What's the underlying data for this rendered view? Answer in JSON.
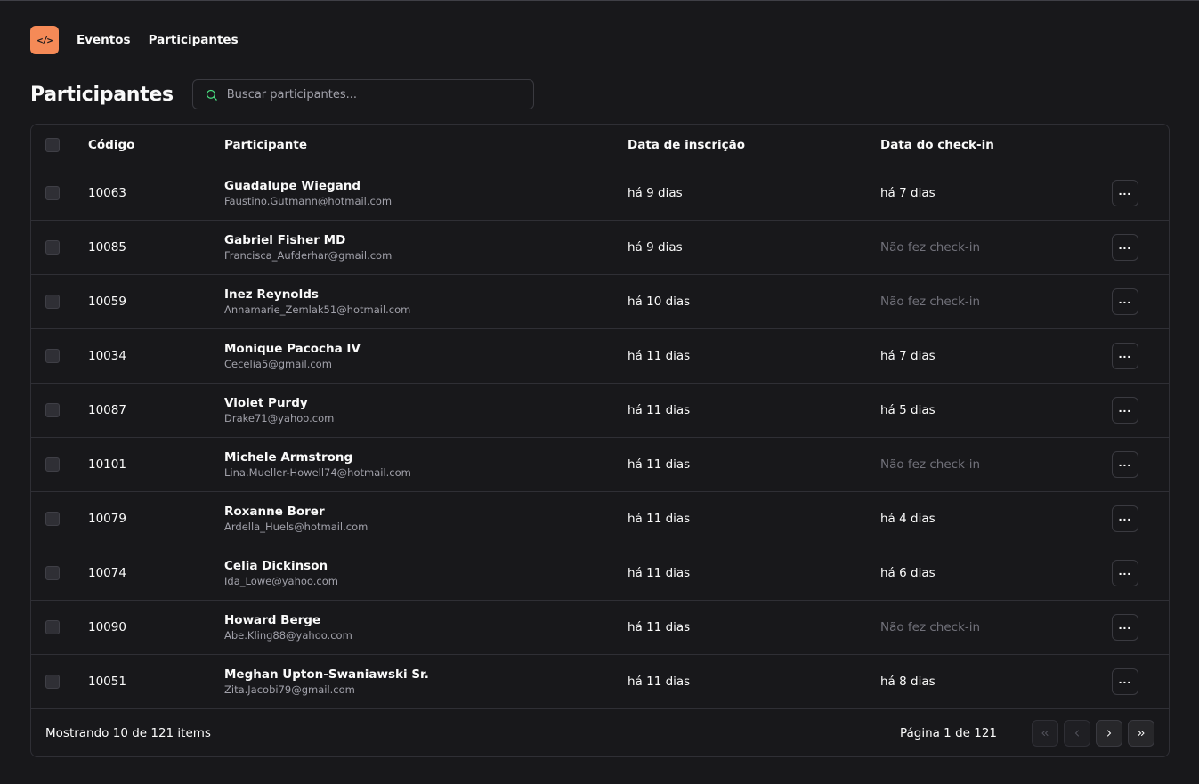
{
  "nav": {
    "logo_text": "</>",
    "items": [
      "Eventos",
      "Participantes"
    ]
  },
  "header": {
    "title": "Participantes",
    "search_placeholder": "Buscar participantes..."
  },
  "table": {
    "columns": [
      "Código",
      "Participante",
      "Data de inscrição",
      "Data do check-in"
    ],
    "rows": [
      {
        "code": "10063",
        "name": "Guadalupe Wiegand",
        "email": "Faustino.Gutmann@hotmail.com",
        "registered": "há 9 dias",
        "checkin": "há 7 dias",
        "checked_in": true
      },
      {
        "code": "10085",
        "name": "Gabriel Fisher MD",
        "email": "Francisca_Aufderhar@gmail.com",
        "registered": "há 9 dias",
        "checkin": "Não fez check-in",
        "checked_in": false
      },
      {
        "code": "10059",
        "name": "Inez Reynolds",
        "email": "Annamarie_Zemlak51@hotmail.com",
        "registered": "há 10 dias",
        "checkin": "Não fez check-in",
        "checked_in": false
      },
      {
        "code": "10034",
        "name": "Monique Pacocha IV",
        "email": "Cecelia5@gmail.com",
        "registered": "há 11 dias",
        "checkin": "há 7 dias",
        "checked_in": true
      },
      {
        "code": "10087",
        "name": "Violet Purdy",
        "email": "Drake71@yahoo.com",
        "registered": "há 11 dias",
        "checkin": "há 5 dias",
        "checked_in": true
      },
      {
        "code": "10101",
        "name": "Michele Armstrong",
        "email": "Lina.Mueller-Howell74@hotmail.com",
        "registered": "há 11 dias",
        "checkin": "Não fez check-in",
        "checked_in": false
      },
      {
        "code": "10079",
        "name": "Roxanne Borer",
        "email": "Ardella_Huels@hotmail.com",
        "registered": "há 11 dias",
        "checkin": "há 4 dias",
        "checked_in": true
      },
      {
        "code": "10074",
        "name": "Celia Dickinson",
        "email": "Ida_Lowe@yahoo.com",
        "registered": "há 11 dias",
        "checkin": "há 6 dias",
        "checked_in": true
      },
      {
        "code": "10090",
        "name": "Howard Berge",
        "email": "Abe.Kling88@yahoo.com",
        "registered": "há 11 dias",
        "checkin": "Não fez check-in",
        "checked_in": false
      },
      {
        "code": "10051",
        "name": "Meghan Upton-Swaniawski Sr.",
        "email": "Zita.Jacobi79@gmail.com",
        "registered": "há 11 dias",
        "checkin": "há 8 dias",
        "checked_in": true
      }
    ]
  },
  "footer": {
    "showing": "Mostrando 10 de 121 items",
    "page_info": "Página 1 de 121"
  },
  "colors": {
    "background": "#18181b",
    "accent": "#f58a57",
    "border": "#2f2f35",
    "muted_text": "#71717a"
  },
  "icons": {
    "logo": "code-brackets-icon",
    "search": "search-icon",
    "row_action": "more-horizontal-icon",
    "first_page": "chevrons-left-icon",
    "prev_page": "chevron-left-icon",
    "next_page": "chevron-right-icon",
    "last_page": "chevrons-right-icon"
  }
}
